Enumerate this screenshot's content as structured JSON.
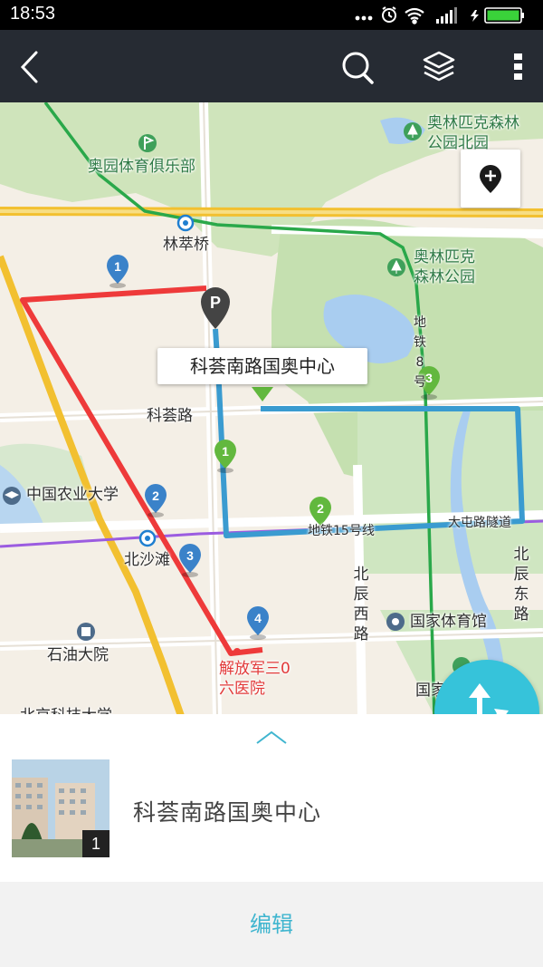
{
  "status_bar": {
    "time": "18:53",
    "icons": [
      "more-dots-icon",
      "alarm-icon",
      "wifi-icon",
      "signal-icon",
      "battery-icon"
    ],
    "battery_color": "#3ad23a"
  },
  "toolbar": {
    "icons": [
      "back-icon",
      "search-icon",
      "layers-icon",
      "overflow-menu-icon"
    ],
    "background": "#262b33"
  },
  "map": {
    "place_labels": {
      "olympic_club": "奥园体育俱乐部",
      "olympic_forest_north": "奥林匹克森林公园北园",
      "olympic_forest": "奥林匹克森林公园",
      "lincui_bridge": "林萃桥",
      "kehui_road": "科荟路",
      "agri_university": "中国农业大学",
      "beishatan": "北沙滩",
      "shiyou": "石油大院",
      "hospital": "解放军三0六医院",
      "national_stadium": "国家体育馆",
      "beichen_west": "北辰西路",
      "beichen_east": "北辰东路",
      "tunnel": "大屯路隧道",
      "metro8": "地铁8号",
      "metro15": "地铁15号线",
      "national_partial": "国家",
      "bottom_partial": "北京科技大学"
    },
    "callout": "科荟南路国奥中心",
    "markers": {
      "blue": [
        "1",
        "2",
        "3",
        "4"
      ],
      "green": [
        "1",
        "2",
        "3"
      ],
      "parking": "P"
    },
    "colors": {
      "red_route": "#ee3a3a",
      "blue_route": "#3a9bd0",
      "green_line": "#2aa84a",
      "purple_line": "#9b5ce0",
      "yellow_road": "#f2c030",
      "park": "#c5e0b0",
      "water": "#a9cdf0",
      "blue_marker": "#3a82c9",
      "green_marker": "#62b83e"
    }
  },
  "actions": {
    "locate_icon": "add-location-icon",
    "route_icon": "route-turn-icon",
    "route_color": "#36c3da"
  },
  "sheet": {
    "chevron_icon": "chevron-up-icon",
    "place_name": "科荟南路国奥中心",
    "photo_count": "1"
  },
  "footer": {
    "edit_label": "编辑"
  }
}
